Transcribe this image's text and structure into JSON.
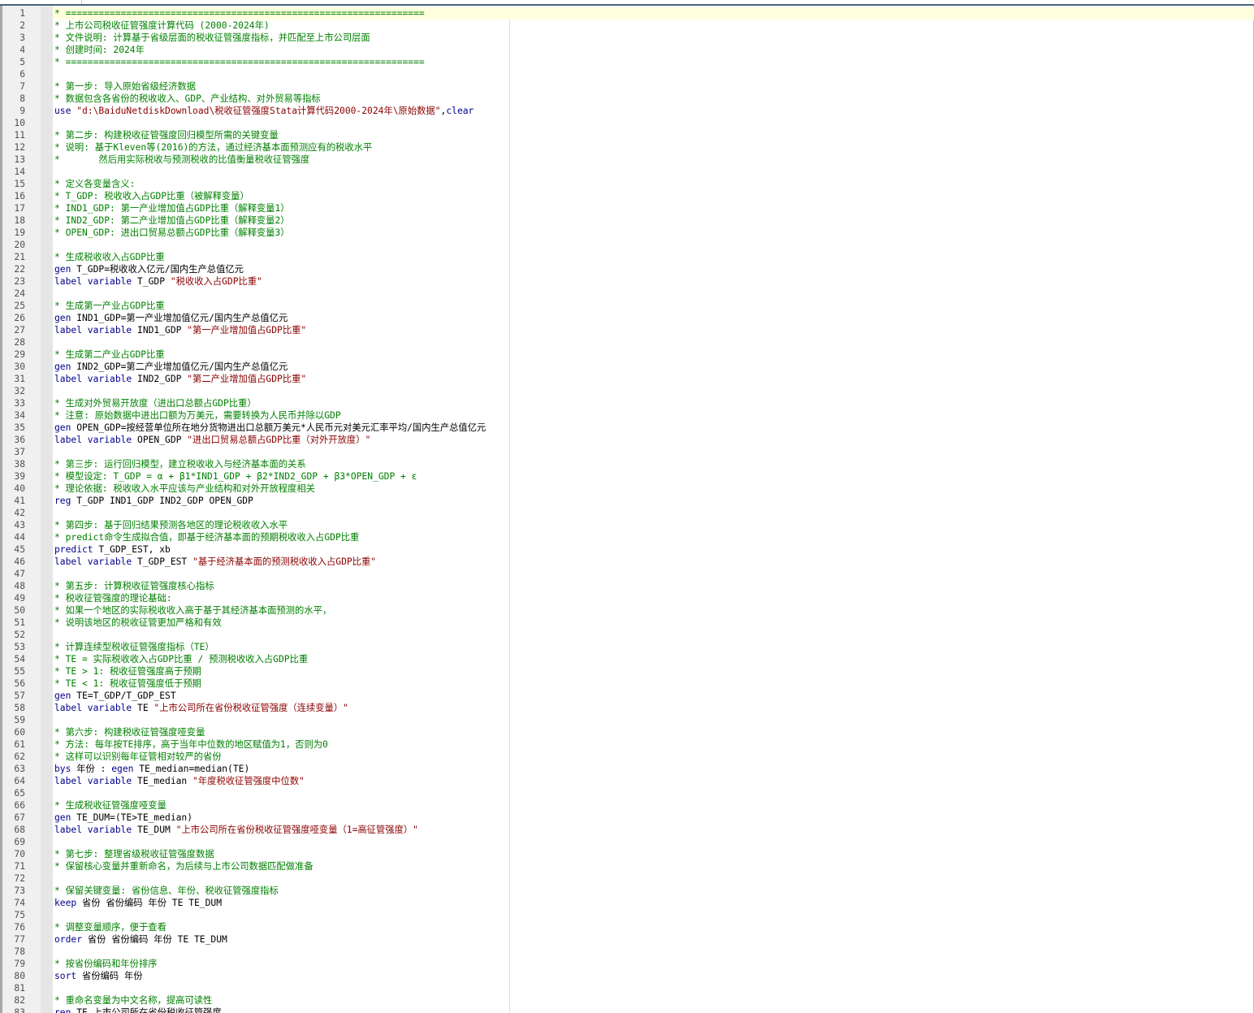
{
  "editor": {
    "colors": {
      "comment": "#008000",
      "keyword": "#00008b",
      "string": "#8b0000",
      "plain": "#000000",
      "current_line": "#ffffdd"
    },
    "current_line": 1,
    "lines": [
      [
        [
          "c",
          "* ================================================================="
        ]
      ],
      [
        [
          "c",
          "* 上市公司税收征管强度计算代码 (2000-2024年)"
        ]
      ],
      [
        [
          "c",
          "* 文件说明: 计算基于省级层面的税收征管强度指标，并匹配至上市公司层面"
        ]
      ],
      [
        [
          "c",
          "* 创建时间: 2024年"
        ]
      ],
      [
        [
          "c",
          "* ================================================================="
        ]
      ],
      [],
      [
        [
          "c",
          "* 第一步: 导入原始省级经济数据"
        ]
      ],
      [
        [
          "c",
          "* 数据包含各省份的税收收入、GDP、产业结构、对外贸易等指标"
        ]
      ],
      [
        [
          "k",
          "use"
        ],
        [
          "n",
          " "
        ],
        [
          "s",
          "\"d:\\BaiduNetdiskDownload\\税收征管强度Stata计算代码2000-2024年\\原始数据\""
        ],
        [
          "n",
          ","
        ],
        [
          "k",
          "clear"
        ]
      ],
      [],
      [
        [
          "c",
          "* 第二步: 构建税收征管强度回归模型所需的关键变量"
        ]
      ],
      [
        [
          "c",
          "* 说明: 基于Kleven等(2016)的方法，通过经济基本面预测应有的税收水平"
        ]
      ],
      [
        [
          "c",
          "*       然后用实际税收与预测税收的比值衡量税收征管强度"
        ]
      ],
      [],
      [
        [
          "c",
          "* 定义各变量含义:"
        ]
      ],
      [
        [
          "c",
          "* T_GDP: 税收收入占GDP比重（被解释变量）"
        ]
      ],
      [
        [
          "c",
          "* IND1_GDP: 第一产业增加值占GDP比重（解释变量1）"
        ]
      ],
      [
        [
          "c",
          "* IND2_GDP: 第二产业增加值占GDP比重（解释变量2）"
        ]
      ],
      [
        [
          "c",
          "* OPEN_GDP: 进出口贸易总额占GDP比重（解释变量3）"
        ]
      ],
      [],
      [
        [
          "c",
          "* 生成税收收入占GDP比重"
        ]
      ],
      [
        [
          "k",
          "gen"
        ],
        [
          "n",
          " T_GDP=税收收入亿元/国内生产总值亿元"
        ]
      ],
      [
        [
          "k",
          "label variable"
        ],
        [
          "n",
          " T_GDP "
        ],
        [
          "s",
          "\"税收收入占GDP比重\""
        ]
      ],
      [],
      [
        [
          "c",
          "* 生成第一产业占GDP比重"
        ]
      ],
      [
        [
          "k",
          "gen"
        ],
        [
          "n",
          " IND1_GDP=第一产业增加值亿元/国内生产总值亿元"
        ]
      ],
      [
        [
          "k",
          "label variable"
        ],
        [
          "n",
          " IND1_GDP "
        ],
        [
          "s",
          "\"第一产业增加值占GDP比重\""
        ]
      ],
      [],
      [
        [
          "c",
          "* 生成第二产业占GDP比重"
        ]
      ],
      [
        [
          "k",
          "gen"
        ],
        [
          "n",
          " IND2_GDP=第二产业增加值亿元/国内生产总值亿元"
        ]
      ],
      [
        [
          "k",
          "label variable"
        ],
        [
          "n",
          " IND2_GDP "
        ],
        [
          "s",
          "\"第二产业增加值占GDP比重\""
        ]
      ],
      [],
      [
        [
          "c",
          "* 生成对外贸易开放度（进出口总额占GDP比重）"
        ]
      ],
      [
        [
          "c",
          "* 注意: 原始数据中进出口额为万美元，需要转换为人民币并除以GDP"
        ]
      ],
      [
        [
          "k",
          "gen"
        ],
        [
          "n",
          " OPEN_GDP=按经营单位所在地分货物进出口总额万美元*人民币元对美元汇率平均/国内生产总值亿元"
        ]
      ],
      [
        [
          "k",
          "label variable"
        ],
        [
          "n",
          " OPEN_GDP "
        ],
        [
          "s",
          "\"进出口贸易总额占GDP比重（对外开放度）\""
        ]
      ],
      [],
      [
        [
          "c",
          "* 第三步: 运行回归模型，建立税收收入与经济基本面的关系"
        ]
      ],
      [
        [
          "c",
          "* 模型设定: T_GDP = α + β1*IND1_GDP + β2*IND2_GDP + β3*OPEN_GDP + ε"
        ]
      ],
      [
        [
          "c",
          "* 理论依据: 税收收入水平应该与产业结构和对外开放程度相关"
        ]
      ],
      [
        [
          "k",
          "reg"
        ],
        [
          "n",
          " T_GDP IND1_GDP IND2_GDP OPEN_GDP"
        ]
      ],
      [],
      [
        [
          "c",
          "* 第四步: 基于回归结果预测各地区的理论税收收入水平"
        ]
      ],
      [
        [
          "c",
          "* predict命令生成拟合值，即基于经济基本面的预期税收收入占GDP比重"
        ]
      ],
      [
        [
          "k",
          "predict"
        ],
        [
          "n",
          " T_GDP_EST, xb"
        ]
      ],
      [
        [
          "k",
          "label variable"
        ],
        [
          "n",
          " T_GDP_EST "
        ],
        [
          "s",
          "\"基于经济基本面的预测税收收入占GDP比重\""
        ]
      ],
      [],
      [
        [
          "c",
          "* 第五步: 计算税收征管强度核心指标"
        ]
      ],
      [
        [
          "c",
          "* 税收征管强度的理论基础:"
        ]
      ],
      [
        [
          "c",
          "* 如果一个地区的实际税收收入高于基于其经济基本面预测的水平，"
        ]
      ],
      [
        [
          "c",
          "* 说明该地区的税收征管更加严格和有效"
        ]
      ],
      [],
      [
        [
          "c",
          "* 计算连续型税收征管强度指标（TE）"
        ]
      ],
      [
        [
          "c",
          "* TE = 实际税收收入占GDP比重 / 预测税收收入占GDP比重"
        ]
      ],
      [
        [
          "c",
          "* TE > 1: 税收征管强度高于预期"
        ]
      ],
      [
        [
          "c",
          "* TE < 1: 税收征管强度低于预期"
        ]
      ],
      [
        [
          "k",
          "gen"
        ],
        [
          "n",
          " TE=T_GDP/T_GDP_EST"
        ]
      ],
      [
        [
          "k",
          "label variable"
        ],
        [
          "n",
          " TE "
        ],
        [
          "s",
          "\"上市公司所在省份税收征管强度（连续变量）\""
        ]
      ],
      [],
      [
        [
          "c",
          "* 第六步: 构建税收征管强度哑变量"
        ]
      ],
      [
        [
          "c",
          "* 方法: 每年按TE排序，高于当年中位数的地区赋值为1，否则为0"
        ]
      ],
      [
        [
          "c",
          "* 这样可以识别每年征管相对较严的省份"
        ]
      ],
      [
        [
          "k",
          "bys"
        ],
        [
          "n",
          " 年份 : "
        ],
        [
          "k",
          "egen"
        ],
        [
          "n",
          " TE_median=median(TE)"
        ]
      ],
      [
        [
          "k",
          "label variable"
        ],
        [
          "n",
          " TE_median "
        ],
        [
          "s",
          "\"年度税收征管强度中位数\""
        ]
      ],
      [],
      [
        [
          "c",
          "* 生成税收征管强度哑变量"
        ]
      ],
      [
        [
          "k",
          "gen"
        ],
        [
          "n",
          " TE_DUM=(TE>TE_median)"
        ]
      ],
      [
        [
          "k",
          "label variable"
        ],
        [
          "n",
          " TE_DUM "
        ],
        [
          "s",
          "\"上市公司所在省份税收征管强度哑变量（1=高征管强度）\""
        ]
      ],
      [],
      [
        [
          "c",
          "* 第七步: 整理省级税收征管强度数据"
        ]
      ],
      [
        [
          "c",
          "* 保留核心变量并重新命名，为后续与上市公司数据匹配做准备"
        ]
      ],
      [],
      [
        [
          "c",
          "* 保留关键变量: 省份信息、年份、税收征管强度指标"
        ]
      ],
      [
        [
          "k",
          "keep"
        ],
        [
          "n",
          " 省份 省份编码 年份 TE TE_DUM"
        ]
      ],
      [],
      [
        [
          "c",
          "* 调整变量顺序，便于查看"
        ]
      ],
      [
        [
          "k",
          "order"
        ],
        [
          "n",
          " 省份 省份编码 年份 TE TE_DUM"
        ]
      ],
      [],
      [
        [
          "c",
          "* 按省份编码和年份排序"
        ]
      ],
      [
        [
          "k",
          "sort"
        ],
        [
          "n",
          " 省份编码 年份"
        ]
      ],
      [],
      [
        [
          "c",
          "* 重命名变量为中文名称，提高可读性"
        ]
      ],
      [
        [
          "k",
          "ren"
        ],
        [
          "n",
          " TE 上市公司所在省份税收征管强度"
        ]
      ]
    ]
  }
}
